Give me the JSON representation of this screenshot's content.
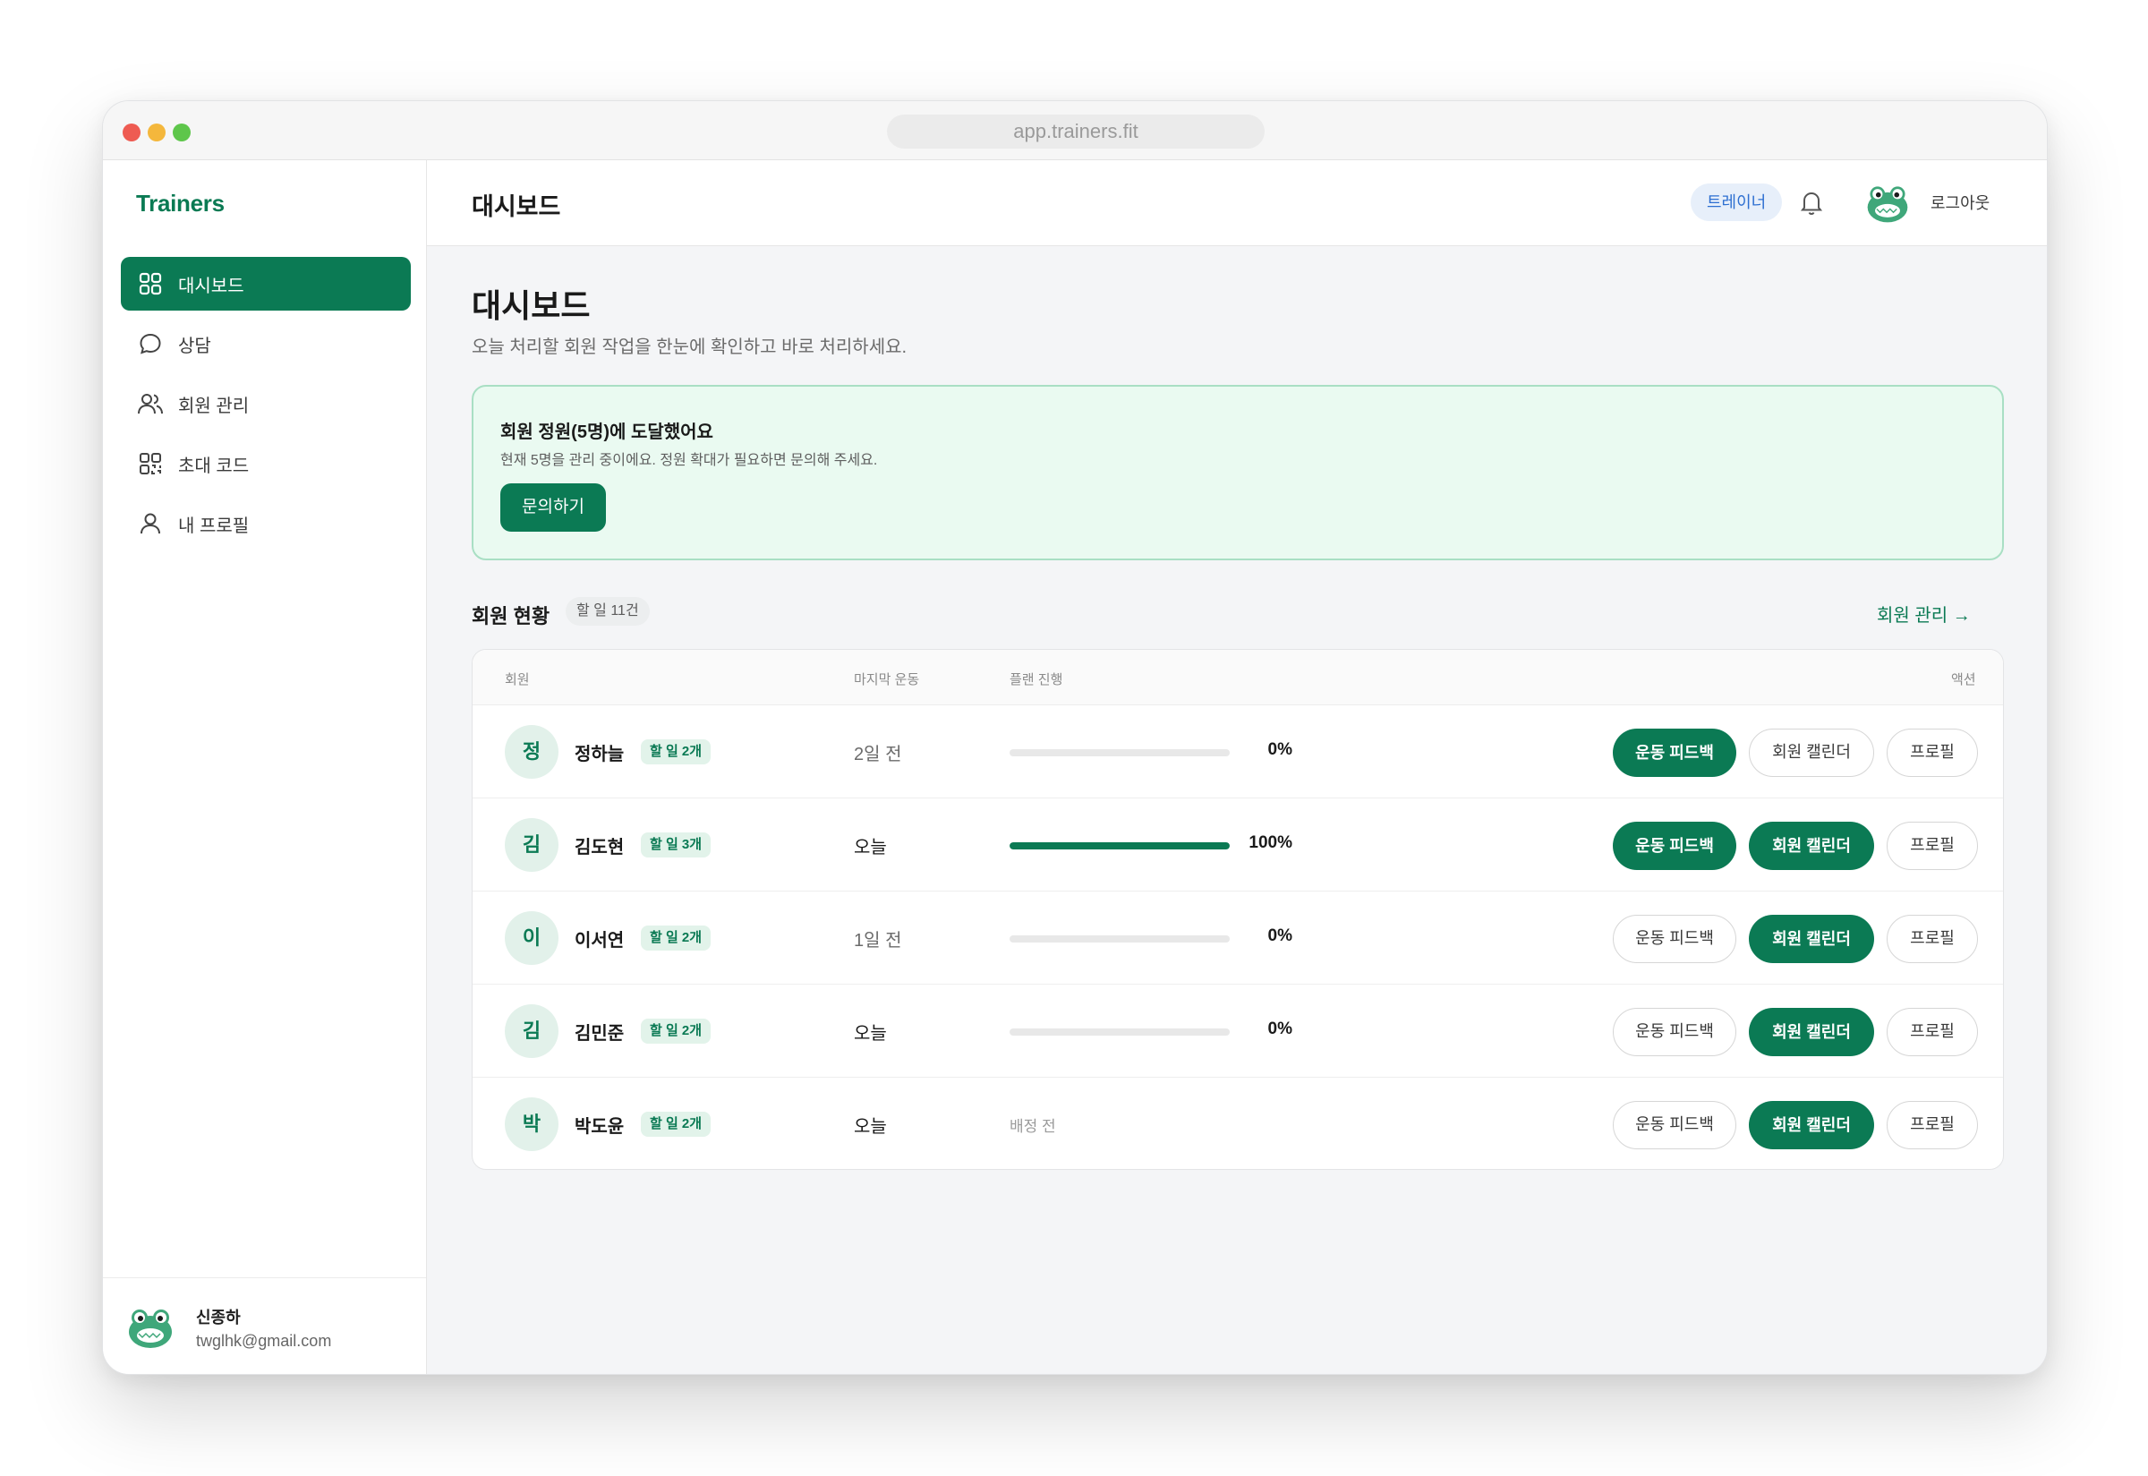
{
  "browser": {
    "url": "app.trainers.fit"
  },
  "sidebar": {
    "brand": "Trainers",
    "items": [
      {
        "label": "대시보드",
        "icon": "grid-icon",
        "active": true
      },
      {
        "label": "상담",
        "icon": "chat-bubble-icon",
        "active": false
      },
      {
        "label": "회원 관리",
        "icon": "users-icon",
        "active": false
      },
      {
        "label": "초대 코드",
        "icon": "qr-code-icon",
        "active": false
      },
      {
        "label": "내 프로필",
        "icon": "user-icon",
        "active": false
      }
    ],
    "user": {
      "name": "신종하",
      "email": "twglhk@gmail.com"
    }
  },
  "topbar": {
    "title": "대시보드",
    "role": "트레이너",
    "logout": "로그아웃"
  },
  "main": {
    "title": "대시보드",
    "subtitle": "오늘 처리할 회원 작업을 한눈에 확인하고 바로 처리하세요.",
    "notice": {
      "title": "회원 정원(5명)에 도달했어요",
      "desc": "현재 5명을 관리 중이에요. 정원 확대가 필요하면 문의해 주세요.",
      "button": "문의하기"
    },
    "members_section": {
      "title": "회원 현황",
      "count": "할 일 11건",
      "manage_link": "회원 관리 →",
      "columns": {
        "member": "회원",
        "last_workout": "마지막 운동",
        "plan_progress": "플랜 진행",
        "actions": "액션"
      },
      "rows": [
        {
          "initial": "정",
          "name": "정하늘",
          "todo": "할 일 2개",
          "last": "2일 전",
          "progress": 0,
          "progress_label": "0%",
          "feedback_primary": true,
          "calendar_primary": false
        },
        {
          "initial": "김",
          "name": "김도현",
          "todo": "할 일 3개",
          "last": "오늘",
          "progress": 100,
          "progress_label": "100%",
          "feedback_primary": true,
          "calendar_primary": true
        },
        {
          "initial": "이",
          "name": "이서연",
          "todo": "할 일 2개",
          "last": "1일 전",
          "progress": 0,
          "progress_label": "0%",
          "feedback_primary": false,
          "calendar_primary": true
        },
        {
          "initial": "김",
          "name": "김민준",
          "todo": "할 일 2개",
          "last": "오늘",
          "progress": 0,
          "progress_label": "0%",
          "feedback_primary": false,
          "calendar_primary": true
        },
        {
          "initial": "박",
          "name": "박도윤",
          "todo": "할 일 2개",
          "last": "오늘",
          "progress": null,
          "progress_label": "배정 전",
          "feedback_primary": false,
          "calendar_primary": true
        }
      ],
      "actions": {
        "feedback": "운동 피드백",
        "calendar": "회원 캘린더",
        "profile": "프로필"
      }
    }
  },
  "colors": {
    "brand_green": "#0b7a54",
    "notice_bg": "#eafaf1",
    "role_badge_bg": "#e7effa"
  }
}
